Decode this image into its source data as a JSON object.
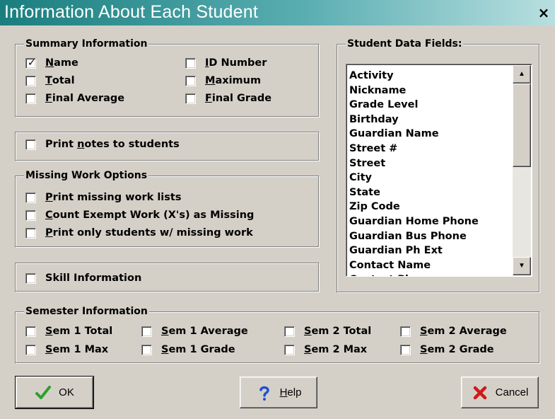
{
  "window": {
    "title": "Information About Each Student",
    "close_label": "×"
  },
  "summary": {
    "legend": "Summary Information",
    "items": [
      {
        "mn": "N",
        "rest": "ame",
        "checked": true
      },
      {
        "mn": "T",
        "rest": "otal",
        "checked": false
      },
      {
        "mn": "F",
        "rest": "inal Average",
        "checked": false
      },
      {
        "mn": "I",
        "rest": "D Number",
        "checked": false
      },
      {
        "mn": "M",
        "rest": "aximum",
        "checked": false
      },
      {
        "mn": "F",
        "rest": "inal Grade",
        "checked": false
      }
    ]
  },
  "notes": {
    "pre": "Print ",
    "mn": "n",
    "rest": "otes to students",
    "checked": false
  },
  "missing": {
    "legend": "Missing Work Options",
    "items": [
      {
        "mn": "P",
        "rest": "rint missing work lists",
        "checked": false
      },
      {
        "mn": "C",
        "rest": "ount Exempt Work (X's) as Missing",
        "checked": false
      },
      {
        "mn": "P",
        "rest": "rint only students w/ missing work",
        "checked": false
      }
    ]
  },
  "skill": {
    "label": "Skill Information",
    "checked": false
  },
  "fields": {
    "legend": "Student Data Fields:",
    "items": [
      "Activity",
      "Nickname",
      "Grade Level",
      "Birthday",
      "Guardian Name",
      "Street #",
      "Street",
      "City",
      "State",
      "Zip Code",
      "Guardian Home Phone",
      "Guardian Bus Phone",
      "Guardian Ph Ext",
      "Contact Name",
      "Contact Phone"
    ],
    "scroll_up": "▲",
    "scroll_down": "▼"
  },
  "semester": {
    "legend": "Semester Information",
    "items": [
      {
        "mn": "S",
        "rest": "em 1 Total",
        "checked": false
      },
      {
        "mn": "S",
        "rest": "em 1 Average",
        "checked": false
      },
      {
        "mn": "S",
        "rest": "em 2 Total",
        "checked": false
      },
      {
        "mn": "S",
        "rest": "em 2 Average",
        "checked": false
      },
      {
        "mn": "S",
        "rest": "em 1 Max",
        "checked": false
      },
      {
        "mn": "S",
        "rest": "em 1 Grade",
        "checked": false
      },
      {
        "mn": "S",
        "rest": "em 2 Max",
        "checked": false
      },
      {
        "mn": "S",
        "rest": "em 2 Grade",
        "checked": false
      }
    ]
  },
  "buttons": {
    "ok": "OK",
    "help_mn": "H",
    "help_rest": "elp",
    "cancel": "Cancel"
  },
  "colors": {
    "title_gradient_start": "#1a7e7e",
    "title_gradient_end": "#b9dfe0",
    "dialog_face": "#d4d0c8",
    "ok_icon": "#2e9e2e",
    "help_icon": "#1f4fd0",
    "cancel_icon": "#d01a1a"
  },
  "icons": {
    "ok": "checkmark-icon",
    "help": "question-mark-icon",
    "cancel": "x-mark-icon",
    "close": "close-icon"
  }
}
